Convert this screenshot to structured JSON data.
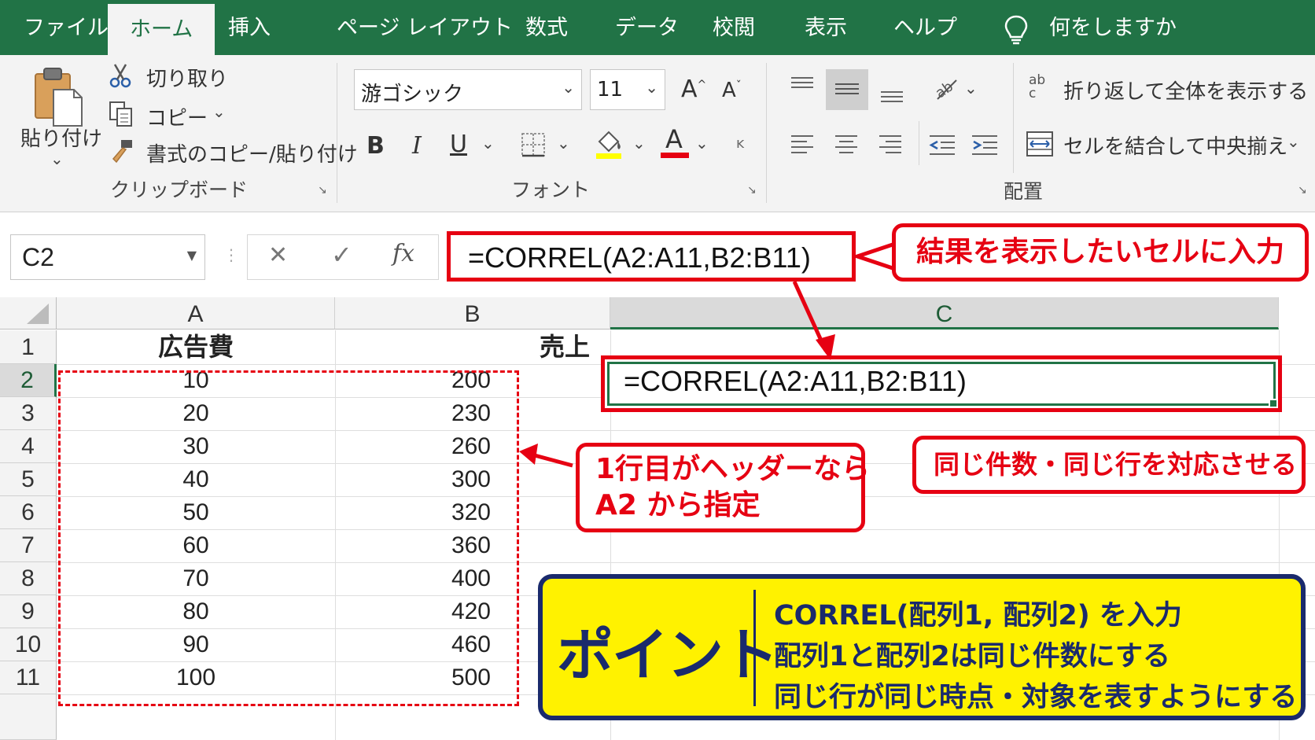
{
  "tabs": [
    "ファイル",
    "ホーム",
    "挿入",
    "ページ レイアウト",
    "数式",
    "データ",
    "校閲",
    "表示",
    "ヘルプ"
  ],
  "tell_me": "何をしますか",
  "clipboard": {
    "paste": "貼り付け",
    "cut": "切り取り",
    "copy": "コピー",
    "format_painter": "書式のコピー/貼り付け",
    "label": "クリップボード"
  },
  "font": {
    "name": "游ゴシック",
    "size": "11",
    "label": "フォント",
    "bold": "B",
    "italic": "I",
    "underline": "U",
    "font_color_glyph": "A",
    "grow_glyph": "A",
    "shrink_glyph": "A",
    "phonetic_glyph": "ĸ",
    "highlight_color": "#ffff00",
    "font_color": "#e60012"
  },
  "alignment": {
    "wrap_text": "折り返して全体を表示する",
    "merge_center": "セルを結合して中央揃え",
    "label": "配置",
    "wrap_glyph": "ab c"
  },
  "formula_bar": {
    "name_box": "C2",
    "cancel": "✕",
    "enter": "✓",
    "fx": "fx",
    "formula": "=CORREL(A2:A11,B2:B11)"
  },
  "sheet": {
    "columns": [
      "A",
      "B",
      "C"
    ],
    "rows": [
      "1",
      "2",
      "3",
      "4",
      "5",
      "6",
      "7",
      "8",
      "9",
      "10",
      "11"
    ],
    "headers": [
      "広告費",
      "売上"
    ],
    "data": [
      [
        "10",
        "200"
      ],
      [
        "20",
        "230"
      ],
      [
        "30",
        "260"
      ],
      [
        "40",
        "300"
      ],
      [
        "50",
        "320"
      ],
      [
        "60",
        "360"
      ],
      [
        "70",
        "400"
      ],
      [
        "80",
        "420"
      ],
      [
        "90",
        "460"
      ],
      [
        "100",
        "500"
      ]
    ],
    "c2_formula": "=CORREL(A2:A11,B2:B11)"
  },
  "annotations": {
    "callout_result": "結果を表示したいセルに入力",
    "callout_header_line1": "1行目がヘッダーなら",
    "callout_header_line2": "A2 から指定",
    "callout_same": "同じ件数・同じ行を対応させる",
    "point_title": "ポイント",
    "point_lines": [
      "CORREL(配列1, 配列2) を入力",
      "配列1と配列2は同じ件数にする",
      "同じ行が同じ時点・対象を表すようにする"
    ]
  },
  "colors": {
    "excel_green": "#217346",
    "annotation_red": "#e60012",
    "point_yellow": "#fff200",
    "point_navy": "#1a2a6c"
  }
}
